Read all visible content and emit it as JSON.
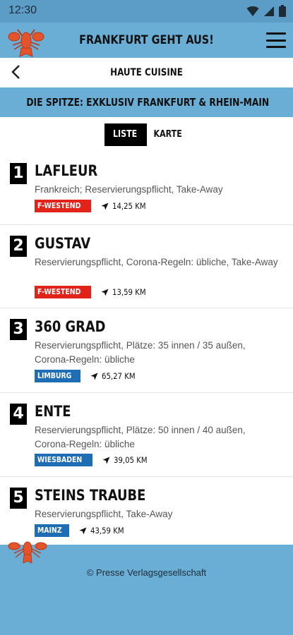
{
  "status": {
    "time": "12:30"
  },
  "app": {
    "title": "FRANKFURT GEHT AUS!"
  },
  "page": {
    "title": "HAUTE CUISINE"
  },
  "banner": {
    "text": "DIE SPITZE: EXKLUSIV FRANKFURT & RHEIN-MAIN"
  },
  "toggle": {
    "list_label": "LISTE",
    "map_label": "KARTE"
  },
  "items": [
    {
      "rank": "1",
      "name": "LAFLEUR",
      "desc": "Frankreich; Reservierungspflicht, Take-Away",
      "district": "F-WESTEND",
      "district_color": "#e2231a",
      "distance": "14,25 KM"
    },
    {
      "rank": "2",
      "name": "GUSTAV",
      "desc": "Reservierungspflicht, Corona-Regeln: übliche, Take-Away",
      "district": "F-WESTEND",
      "district_color": "#e2231a",
      "distance": "13,59 KM"
    },
    {
      "rank": "3",
      "name": "360 GRAD",
      "desc": "Reservierungspflicht, Plätze: 35 innen / 35 außen, Corona-Regeln: übliche",
      "district": "LIMBURG",
      "district_color": "#1f6eb5",
      "distance": "65,27 KM"
    },
    {
      "rank": "4",
      "name": "ENTE",
      "desc": "Reservierungspflicht, Plätze: 50 innen / 40 außen, Corona-Regeln: übliche",
      "district": "WIESBADEN",
      "district_color": "#1f6eb5",
      "distance": "39,05 KM"
    },
    {
      "rank": "5",
      "name": "STEINS TRAUBE",
      "desc": "Reservierungspflicht, Take-Away",
      "district": "MAINZ",
      "district_color": "#1f6eb5",
      "distance": "43,59 KM"
    }
  ],
  "footer": {
    "copyright": "© Presse Verlagsgesellschaft"
  },
  "icons": {
    "logo": "lobster-icon",
    "menu": "hamburger-menu-icon",
    "back": "back-arrow-icon",
    "distance": "navigation-arrow-icon"
  },
  "colors": {
    "brand_blue": "#6aaed6",
    "red_badge": "#e2231a",
    "blue_badge": "#1f6eb5"
  }
}
